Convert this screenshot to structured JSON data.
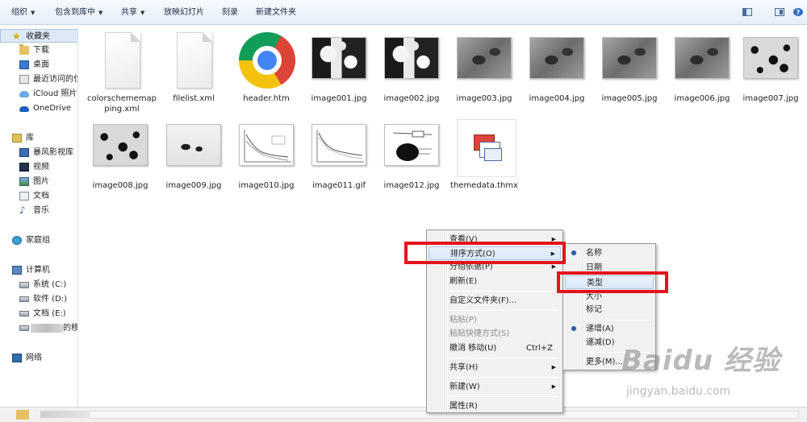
{
  "toolbar": {
    "buttons": [
      {
        "label": "组织",
        "dropdown": true
      },
      {
        "label": "包含到库中",
        "dropdown": true
      },
      {
        "label": "共享",
        "dropdown": true
      },
      {
        "label": "放映幻灯片",
        "dropdown": false
      },
      {
        "label": "刻录",
        "dropdown": false
      },
      {
        "label": "新建文件夹",
        "dropdown": false
      }
    ],
    "dropdown_arrow": "▼",
    "right_icons": [
      "change-view-icon",
      "preview-pane-icon",
      "help-icon"
    ],
    "help_glyph": "?"
  },
  "sidebar": {
    "favorites": {
      "label": "收藏夹",
      "icon": "star-icon"
    },
    "favorite_items": [
      {
        "label": "下载",
        "icon": "downloads-folder-icon"
      },
      {
        "label": "桌面",
        "icon": "desktop-icon"
      },
      {
        "label": "最近访问的位",
        "icon": "recent-places-icon"
      },
      {
        "label": "iCloud 照片",
        "icon": "icloud-icon"
      },
      {
        "label": "OneDrive",
        "icon": "onedrive-icon"
      }
    ],
    "libraries": {
      "label": "库",
      "icon": "library-icon"
    },
    "library_items": [
      {
        "label": "暴风影视库",
        "icon": "media-library-icon"
      },
      {
        "label": "视频",
        "icon": "video-icon"
      },
      {
        "label": "图片",
        "icon": "pictures-icon"
      },
      {
        "label": "文档",
        "icon": "documents-icon"
      },
      {
        "label": "音乐",
        "icon": "music-icon"
      }
    ],
    "homegroup": {
      "label": "家庭组",
      "icon": "homegroup-icon"
    },
    "computer": {
      "label": "计算机",
      "icon": "computer-icon"
    },
    "drives": [
      {
        "label": "系统 (C:)",
        "icon": "system-drive-icon"
      },
      {
        "label": "软件 (D:)",
        "icon": "drive-icon"
      },
      {
        "label": "文档 (E:)",
        "icon": "drive-icon"
      },
      {
        "label": "的移动",
        "icon": "removable-drive-icon"
      }
    ],
    "network": {
      "label": "网络",
      "icon": "network-icon"
    }
  },
  "files": [
    {
      "name": "colorschememapping.xml",
      "kind": "doc"
    },
    {
      "name": "filelist.xml",
      "kind": "doc"
    },
    {
      "name": "header.htm",
      "kind": "chrome"
    },
    {
      "name": "image001.jpg",
      "kind": "dark"
    },
    {
      "name": "image002.jpg",
      "kind": "dark"
    },
    {
      "name": "image003.jpg",
      "kind": "grey"
    },
    {
      "name": "image004.jpg",
      "kind": "grey"
    },
    {
      "name": "image005.jpg",
      "kind": "grey"
    },
    {
      "name": "image006.jpg",
      "kind": "grey"
    },
    {
      "name": "image007.jpg",
      "kind": "speckle"
    },
    {
      "name": "image008.jpg",
      "kind": "speckle"
    },
    {
      "name": "image009.jpg",
      "kind": "light"
    },
    {
      "name": "image010.jpg",
      "kind": "chart"
    },
    {
      "name": "image011.gif",
      "kind": "chart"
    },
    {
      "name": "image012.jpg",
      "kind": "diagram"
    },
    {
      "name": "themedata.thmx",
      "kind": "theme"
    }
  ],
  "context_menu": {
    "items": [
      {
        "label": "查看(V)",
        "submenu": true
      },
      {
        "label": "排序方式(O)",
        "submenu": true,
        "highlighted": true
      },
      {
        "label": "分组依据(P)",
        "submenu": true
      },
      {
        "label": "刷新(E)"
      },
      {
        "label": "自定义文件夹(F)..."
      },
      {
        "label": "粘贴(P)",
        "disabled": true
      },
      {
        "label": "粘贴快捷方式(S)",
        "disabled": true
      },
      {
        "label": "撤消 移动(U)",
        "shortcut": "Ctrl+Z"
      },
      {
        "label": "共享(H)",
        "submenu": true
      },
      {
        "label": "新建(W)",
        "submenu": true
      },
      {
        "label": "属性(R)"
      }
    ],
    "submenu_arrow": "▶"
  },
  "sort_submenu": {
    "items": [
      {
        "label": "名称",
        "checked": true
      },
      {
        "label": "日期"
      },
      {
        "label": "类型",
        "highlighted": true
      },
      {
        "label": "大小"
      },
      {
        "label": "标记"
      },
      {
        "label": "递增(A)",
        "checked": true
      },
      {
        "label": "递减(D)"
      },
      {
        "label": "更多(M)..."
      }
    ]
  },
  "watermark": {
    "main": "Baidu 经验",
    "sub": "jingyan.baidu.com"
  },
  "colors": {
    "highlight_box": "#e3141b",
    "menu_hover": "#d8e7f8",
    "radio": "#2a5fa8"
  }
}
